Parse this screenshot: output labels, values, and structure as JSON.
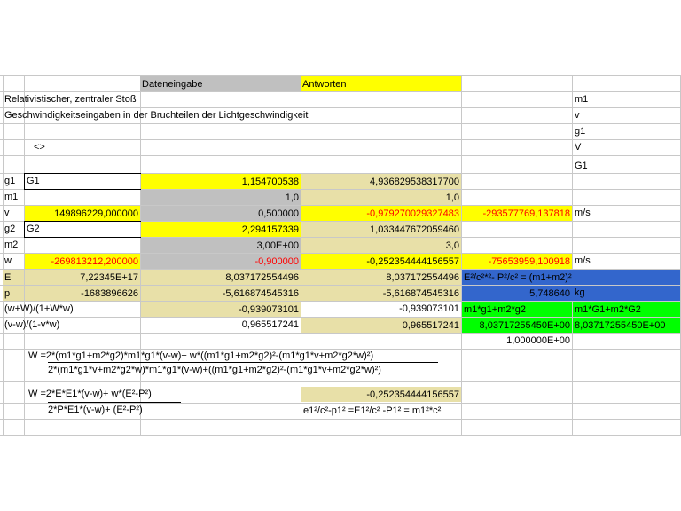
{
  "sheet": {
    "header_input": "Dateneingabe",
    "header_answers": "Antworten",
    "title": "Relativistischer, zentraler Stoß",
    "subtitle": "Geschwindigkeitseingaben in der Bruchteilen der Lichtgeschwindigkeit",
    "marker": "<>",
    "side_labels": [
      "m1",
      "v",
      "g1",
      "V",
      "G1"
    ],
    "row_labels": [
      "g1",
      "m1",
      "v",
      "g2",
      "m2",
      "w",
      "E",
      "p",
      "(w+W)/(1+W*w)",
      "(v-w)/(1-v*w)"
    ],
    "colB": {
      "g1": "G1",
      "v": "149896229,000000",
      "g2": "G2",
      "w": "-269813212,200000",
      "E": "7,22345E+17",
      "p": "-1683896626"
    },
    "colC": {
      "g1": "1,154700538",
      "m1": "1,0",
      "v": "0,500000",
      "g2": "2,294157339",
      "m2": "3,00E+00",
      "w": "-0,900000",
      "E": "8,037172554496",
      "p": "-5,616874545316",
      "r9": "-0,939073101",
      "r10": "0,965517241"
    },
    "colD": {
      "g1": "4,936829538317700",
      "m1": "1,0",
      "v": "-0,979270029327483",
      "g2": "1,033447672059460",
      "m2": "3,0",
      "w": "-0,252354444156557",
      "E": "8,037172554496",
      "p": "-5,616874545316",
      "r9": "-0,939073101",
      "r10": "0,965517241"
    },
    "colE": {
      "v": "-293577769,137818",
      "w": "-75653959,100918",
      "E": "E²/c²*²- P²/c² = (m1+m2)²",
      "p": "5,748640",
      "r9": "m1*g1+m2*g2",
      "r10": "8,03717255450E+00",
      "r11": "1,000000E+00"
    },
    "colF": {
      "v": "m/s",
      "w": "m/s",
      "p": "kg",
      "r9": "m1*G1+m2*G2",
      "r10": "8,03717255450E+00"
    },
    "formula1_num": "W =2*(m1*g1+m2*g2)*m1*g1*(v-w)+    w*((m1*g1+m2*g2)²-(m1*g1*v+m2*g2*w)²)",
    "formula1_den": "2*(m1*g1*v+m2*g2*w)*m1*g1*(v-w)+((m1*g1+m2*g2)²-(m1*g1*v+m2*g2*w)²)",
    "formula2_num": "W =2*E*E1*(v-w)+ w*(E²-P²)",
    "formula2_den": "2*P*E1*(v-w)+      (E²-P²)",
    "formula2_result": "-0,252354444156557",
    "formula3": "e1²/c²-p1² =E1²/c² -P1² = m1²*c²"
  }
}
